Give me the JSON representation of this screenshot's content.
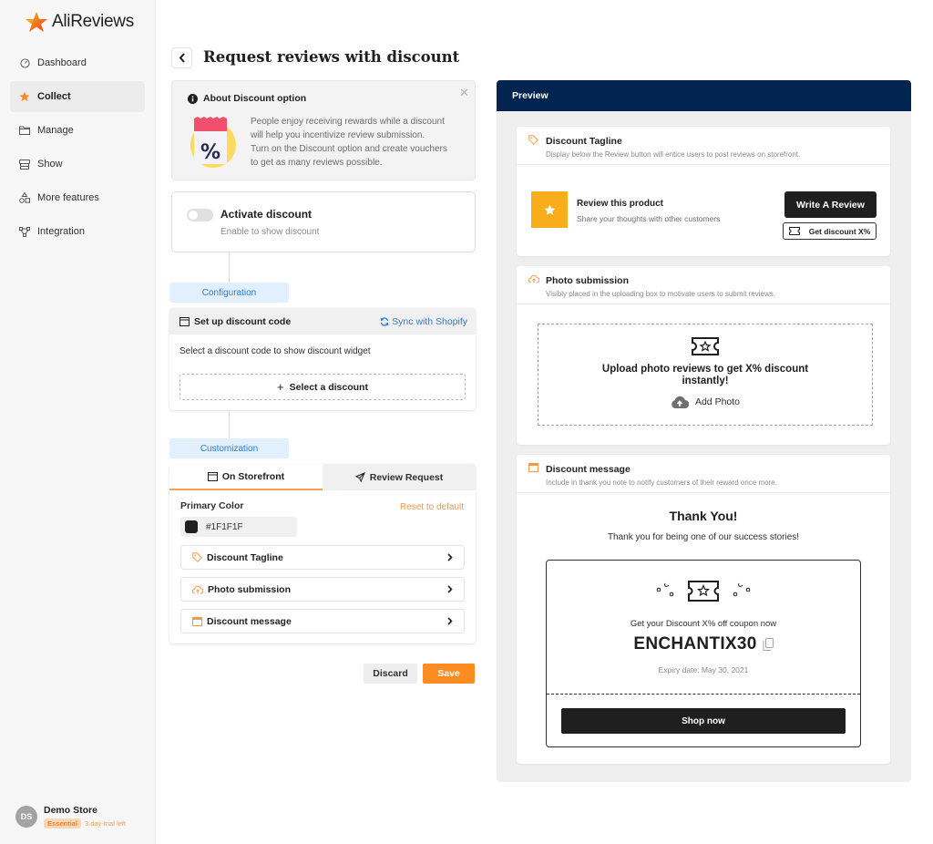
{
  "app": {
    "brand": "AliReviews",
    "colors": {
      "accent": "#FB8C22",
      "preview_header": "#00234F",
      "link": "#2D7ED9",
      "step_bg": "#E1EFFF"
    }
  },
  "sidebar": {
    "items": [
      {
        "label": "Dashboard",
        "icon": "dashboard-icon",
        "active": false
      },
      {
        "label": "Collect",
        "icon": "star-icon",
        "active": true
      },
      {
        "label": "Manage",
        "icon": "folder-icon",
        "active": false
      },
      {
        "label": "Show",
        "icon": "store-icon",
        "active": false
      },
      {
        "label": "More features",
        "icon": "shapes-icon",
        "active": false
      },
      {
        "label": "Integration",
        "icon": "integration-icon",
        "active": false
      }
    ],
    "store": {
      "initials": "DS",
      "name": "Demo Store",
      "plan": "Essential",
      "trial": "3 day-trial left"
    }
  },
  "header": {
    "title": "Request reviews with discount"
  },
  "info": {
    "title": "About Discount option",
    "lines": [
      "People enjoy receiving rewards while a discount",
      "will help you incentivize review submission.",
      "Turn on the Discount option and create vouchers",
      "to get as many reviews possible."
    ]
  },
  "activate": {
    "title": "Activate discount",
    "subtitle": "Enable to show discount",
    "enabled": false
  },
  "configuration": {
    "step_label": "Configuration",
    "title": "Set up discount code",
    "sync_label": "Sync with Shopify",
    "description": "Select a discount code to show discount widget",
    "select_label": "Select a discount"
  },
  "customization": {
    "step_label": "Customization",
    "tabs": [
      {
        "label": "On Storefront",
        "active": true
      },
      {
        "label": "Review Request",
        "active": false
      }
    ],
    "primary_color_label": "Primary Color",
    "reset_label": "Reset to default",
    "primary_color_value": "#1F1F1F",
    "items": [
      {
        "label": "Discount Tagline",
        "icon": "tag-icon"
      },
      {
        "label": "Photo submission",
        "icon": "cloud-upload-icon"
      },
      {
        "label": "Discount message",
        "icon": "window-icon"
      }
    ]
  },
  "actions": {
    "discard": "Discard",
    "save": "Save"
  },
  "preview": {
    "title": "Preview",
    "tagline": {
      "title": "Discount Tagline",
      "subtitle": "Display below the Review button will entice users to post reviews on storefront.",
      "product_title": "Review this product",
      "product_sub": "Share your thoughts with other customers",
      "write_review": "Write A Review",
      "get_discount": "Get discount X%"
    },
    "photo": {
      "title": "Photo submission",
      "subtitle": "Visibly placed in the uploading box to motivate users to submit reviews.",
      "upload_text": "Upload photo reviews to get X% discount instantly!",
      "add_photo": "Add Photo"
    },
    "message": {
      "title": "Discount message",
      "subtitle": "Include in thank you note to notify customers of their reward once more.",
      "thank_title": "Thank You!",
      "thank_sub": "Thank you for being one of our success stories!",
      "coupon_label": "Get your Discount X% off coupon now",
      "coupon_code": "ENCHANTIX30",
      "expiry": "Expiry date: May 30, 2021",
      "shop_now": "Shop now"
    }
  }
}
